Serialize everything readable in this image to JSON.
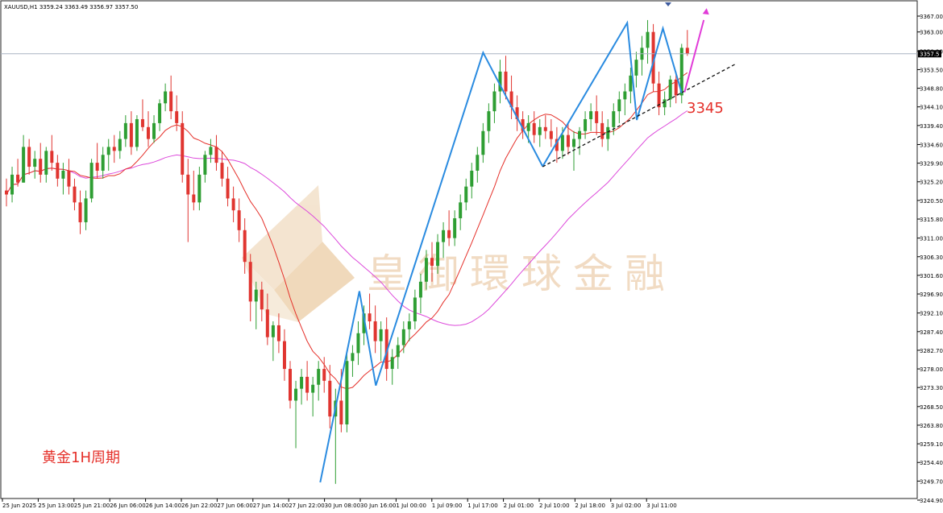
{
  "header": {
    "text": "XAUUSD,H1  3359.24 3363.49 3356.97 3357.50"
  },
  "watermark": "皇御環球金融",
  "chart_data": {
    "type": "candlestick",
    "symbol": "XAUUSD",
    "timeframe": "H1",
    "ohlc_header": {
      "open": 3359.24,
      "high": 3363.49,
      "low": 3356.97,
      "close": 3357.5
    },
    "current_price": 3357.5,
    "ylim": [
      3244.9,
      3370.5
    ],
    "y_ticks": [
      "3367.00",
      "3363.00",
      "3358.20",
      "3353.50",
      "3348.80",
      "3344.10",
      "3339.40",
      "3334.60",
      "3329.90",
      "3325.20",
      "3320.50",
      "3315.80",
      "3311.00",
      "3306.30",
      "3301.60",
      "3296.90",
      "3292.10",
      "3287.40",
      "3282.70",
      "3278.00",
      "3273.30",
      "3268.50",
      "3263.80",
      "3259.10",
      "3254.40",
      "3249.70",
      "3244.90"
    ],
    "x_ticks": [
      "25 Jun 2025",
      "25 Jun 13:00",
      "25 Jun 21:00",
      "26 Jun 06:00",
      "26 Jun 14:00",
      "26 Jun 22:00",
      "27 Jun 06:00",
      "27 Jun 14:00",
      "27 Jun 22:00",
      "30 Jun 08:00",
      "30 Jun 16:00",
      "1 Jul 00:00",
      "1 Jul 09:00",
      "1 Jul 17:00",
      "2 Jul 01:00",
      "2 Jul 10:00",
      "2 Jul 18:00",
      "3 Jul 02:00",
      "3 Jul 11:00"
    ],
    "candles": [
      [
        3323,
        3326,
        3319,
        3322
      ],
      [
        3322,
        3329,
        3320,
        3327
      ],
      [
        3327,
        3331,
        3324,
        3325
      ],
      [
        3325,
        3337,
        3325,
        3334
      ],
      [
        3334,
        3336,
        3327,
        3329
      ],
      [
        3329,
        3333,
        3326,
        3331
      ],
      [
        3331,
        3335,
        3325,
        3327
      ],
      [
        3327,
        3334,
        3325,
        3333
      ],
      [
        3333,
        3337,
        3328,
        3330
      ],
      [
        3330,
        3332,
        3324,
        3326
      ],
      [
        3326,
        3330,
        3322,
        3328
      ],
      [
        3328,
        3331,
        3322,
        3324
      ],
      [
        3324,
        3326,
        3318,
        3320
      ],
      [
        3320,
        3323,
        3312,
        3315
      ],
      [
        3315,
        3323,
        3313,
        3321
      ],
      [
        3321,
        3331,
        3320,
        3330
      ],
      [
        3330,
        3335,
        3326,
        3328
      ],
      [
        3328,
        3334,
        3326,
        3332
      ],
      [
        3332,
        3336,
        3328,
        3334
      ],
      [
        3334,
        3337,
        3330,
        3333
      ],
      [
        3333,
        3338,
        3331,
        3336
      ],
      [
        3336,
        3342,
        3334,
        3340
      ],
      [
        3340,
        3343,
        3332,
        3334
      ],
      [
        3334,
        3342,
        3333,
        3341
      ],
      [
        3341,
        3346,
        3338,
        3339
      ],
      [
        3339,
        3343,
        3334,
        3336
      ],
      [
        3336,
        3342,
        3335,
        3340
      ],
      [
        3340,
        3346,
        3338,
        3345
      ],
      [
        3345,
        3350,
        3343,
        3348
      ],
      [
        3348,
        3352,
        3341,
        3343
      ],
      [
        3343,
        3347,
        3338,
        3340
      ],
      [
        3340,
        3343,
        3325,
        3327
      ],
      [
        3327,
        3331,
        3310,
        3322
      ],
      [
        3322,
        3328,
        3318,
        3320
      ],
      [
        3320,
        3329,
        3318,
        3327
      ],
      [
        3327,
        3333,
        3325,
        3332
      ],
      [
        3332,
        3336,
        3330,
        3334
      ],
      [
        3334,
        3337,
        3328,
        3330
      ],
      [
        3330,
        3333,
        3324,
        3326
      ],
      [
        3326,
        3329,
        3319,
        3321
      ],
      [
        3321,
        3324,
        3315,
        3318
      ],
      [
        3318,
        3321,
        3310,
        3313
      ],
      [
        3313,
        3316,
        3302,
        3305
      ],
      [
        3305,
        3307,
        3290,
        3295
      ],
      [
        3295,
        3300,
        3288,
        3298
      ],
      [
        3298,
        3300,
        3290,
        3293
      ],
      [
        3293,
        3297,
        3284,
        3286
      ],
      [
        3286,
        3290,
        3280,
        3289
      ],
      [
        3289,
        3292,
        3282,
        3285
      ],
      [
        3285,
        3288,
        3275,
        3278
      ],
      [
        3278,
        3280,
        3268,
        3270
      ],
      [
        3270,
        3275,
        3258,
        3273
      ],
      [
        3273,
        3278,
        3269,
        3276
      ],
      [
        3276,
        3280,
        3270,
        3272
      ],
      [
        3272,
        3276,
        3266,
        3274
      ],
      [
        3274,
        3280,
        3270,
        3278
      ],
      [
        3278,
        3281,
        3272,
        3275
      ],
      [
        3275,
        3279,
        3263,
        3266
      ],
      [
        3266,
        3273,
        3249,
        3270
      ],
      [
        3270,
        3278,
        3262,
        3264
      ],
      [
        3264,
        3282,
        3262,
        3280
      ],
      [
        3280,
        3284,
        3276,
        3282
      ],
      [
        3282,
        3290,
        3279,
        3287
      ],
      [
        3287,
        3294,
        3284,
        3292
      ],
      [
        3292,
        3297,
        3288,
        3290
      ],
      [
        3290,
        3294,
        3282,
        3285
      ],
      [
        3285,
        3290,
        3280,
        3288
      ],
      [
        3288,
        3291,
        3275,
        3278
      ],
      [
        3278,
        3283,
        3274,
        3281
      ],
      [
        3281,
        3286,
        3278,
        3284
      ],
      [
        3284,
        3290,
        3282,
        3288
      ],
      [
        3288,
        3292,
        3285,
        3290
      ],
      [
        3290,
        3298,
        3288,
        3296
      ],
      [
        3296,
        3302,
        3292,
        3300
      ],
      [
        3300,
        3308,
        3298,
        3306
      ],
      [
        3306,
        3310,
        3300,
        3304
      ],
      [
        3304,
        3312,
        3302,
        3310
      ],
      [
        3310,
        3315,
        3306,
        3313
      ],
      [
        3313,
        3318,
        3309,
        3311
      ],
      [
        3311,
        3318,
        3309,
        3316
      ],
      [
        3316,
        3322,
        3313,
        3320
      ],
      [
        3320,
        3326,
        3318,
        3324
      ],
      [
        3324,
        3330,
        3321,
        3328
      ],
      [
        3328,
        3334,
        3325,
        3332
      ],
      [
        3332,
        3340,
        3330,
        3338
      ],
      [
        3338,
        3345,
        3335,
        3343
      ],
      [
        3343,
        3350,
        3340,
        3348
      ],
      [
        3348,
        3356,
        3345,
        3353
      ],
      [
        3353,
        3357,
        3346,
        3348
      ],
      [
        3348,
        3352,
        3341,
        3344
      ],
      [
        3344,
        3347,
        3338,
        3341
      ],
      [
        3341,
        3343,
        3336,
        3338
      ],
      [
        3338,
        3342,
        3335,
        3340
      ],
      [
        3340,
        3343,
        3335,
        3337
      ],
      [
        3337,
        3341,
        3334,
        3339
      ],
      [
        3339,
        3342,
        3336,
        3338
      ],
      [
        3338,
        3341,
        3334,
        3336
      ],
      [
        3336,
        3339,
        3330,
        3333
      ],
      [
        3333,
        3339,
        3331,
        3337
      ],
      [
        3337,
        3340,
        3332,
        3334
      ],
      [
        3334,
        3338,
        3328,
        3336
      ],
      [
        3336,
        3339,
        3332,
        3338
      ],
      [
        3338,
        3343,
        3336,
        3341
      ],
      [
        3341,
        3345,
        3338,
        3343
      ],
      [
        3343,
        3347,
        3337,
        3340
      ],
      [
        3340,
        3343,
        3334,
        3336
      ],
      [
        3336,
        3341,
        3333,
        3339
      ],
      [
        3339,
        3345,
        3337,
        3343
      ],
      [
        3343,
        3348,
        3340,
        3346
      ],
      [
        3346,
        3350,
        3342,
        3348
      ],
      [
        3348,
        3354,
        3345,
        3352
      ],
      [
        3352,
        3358,
        3349,
        3356
      ],
      [
        3356,
        3362,
        3352,
        3359
      ],
      [
        3359,
        3366,
        3355,
        3363
      ],
      [
        3363,
        3365,
        3348,
        3350
      ],
      [
        3350,
        3353,
        3342,
        3344
      ],
      [
        3344,
        3348,
        3342,
        3346
      ],
      [
        3346,
        3352,
        3344,
        3351
      ],
      [
        3351,
        3353,
        3345,
        3347
      ],
      [
        3347,
        3360,
        3345,
        3359
      ],
      [
        3359,
        3363.49,
        3356.97,
        3357.5
      ]
    ],
    "annotations": {
      "target_label": "3345",
      "caption": "黄金1H周期"
    }
  }
}
